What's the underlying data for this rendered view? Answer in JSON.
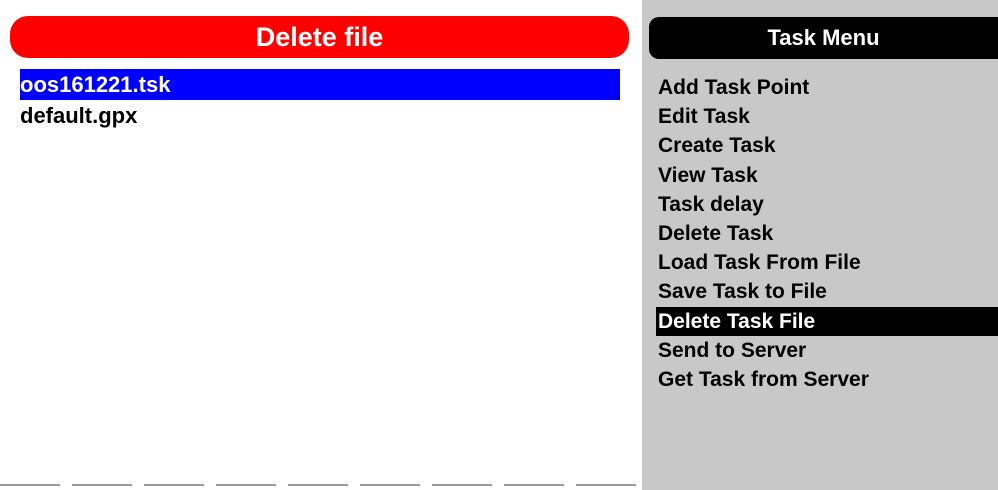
{
  "delete_dialog": {
    "title": "Delete file",
    "files": [
      {
        "name": "oos161221.tsk",
        "selected": true
      },
      {
        "name": "default.gpx",
        "selected": false
      }
    ]
  },
  "task_menu": {
    "title": "Task Menu",
    "items": [
      {
        "label": "Add Task Point",
        "selected": false
      },
      {
        "label": "Edit Task",
        "selected": false
      },
      {
        "label": "Create Task",
        "selected": false
      },
      {
        "label": "View Task",
        "selected": false
      },
      {
        "label": "Task delay",
        "selected": false
      },
      {
        "label": "Delete Task",
        "selected": false
      },
      {
        "label": "Load Task From File",
        "selected": false
      },
      {
        "label": "Save Task to File",
        "selected": false
      },
      {
        "label": "Delete Task File",
        "selected": true
      },
      {
        "label": "Send to Server",
        "selected": false
      },
      {
        "label": "Get Task from Server",
        "selected": false
      }
    ]
  },
  "colors": {
    "dialog_header": "#ff0000",
    "file_selection": "#0000ff",
    "menu_background": "#c8c8c8",
    "menu_header": "#000000",
    "menu_selection": "#000000"
  }
}
